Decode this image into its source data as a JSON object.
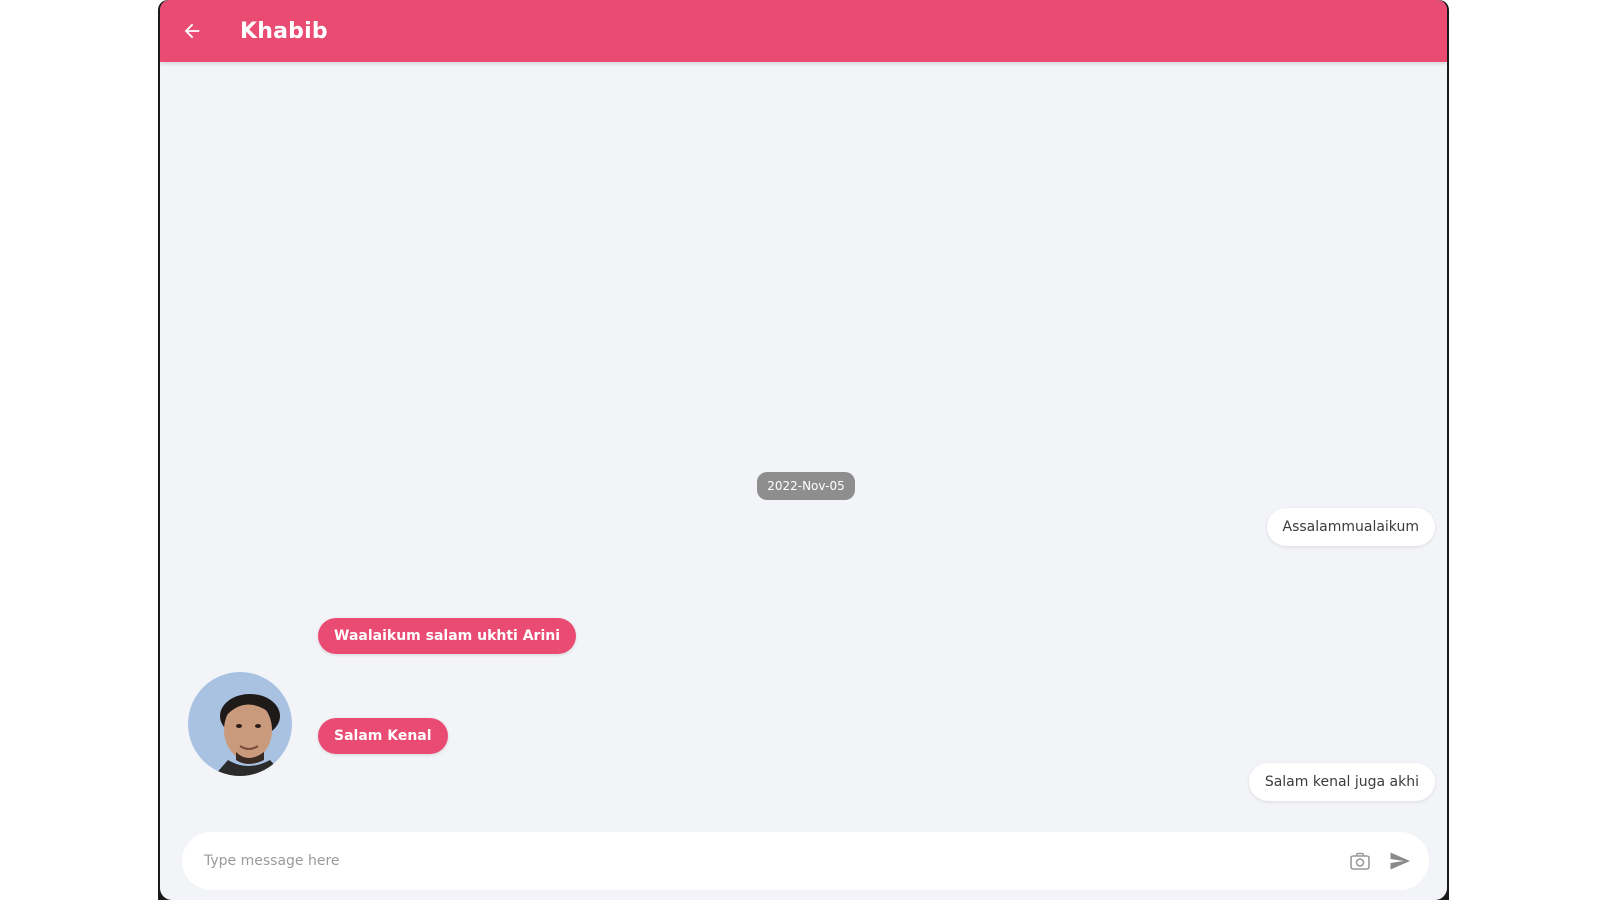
{
  "header": {
    "title": "Khabib",
    "back_icon": "arrow-left-icon",
    "color": "#e94b72"
  },
  "chat": {
    "date_divider": "2022-Nov-05",
    "messages": [
      {
        "direction": "outgoing",
        "text": "Assalammualaikum"
      },
      {
        "direction": "incoming",
        "text": "Waalaikum salam ukhti Arini"
      },
      {
        "direction": "incoming",
        "text": "Salam Kenal"
      },
      {
        "direction": "outgoing",
        "text": "Salam kenal juga akhi"
      }
    ],
    "incoming_bubble_color": "#e94b72",
    "outgoing_bubble_color": "#ffffff"
  },
  "composer": {
    "placeholder": "Type message here",
    "camera_icon": "camera-icon",
    "send_icon": "send-icon"
  }
}
